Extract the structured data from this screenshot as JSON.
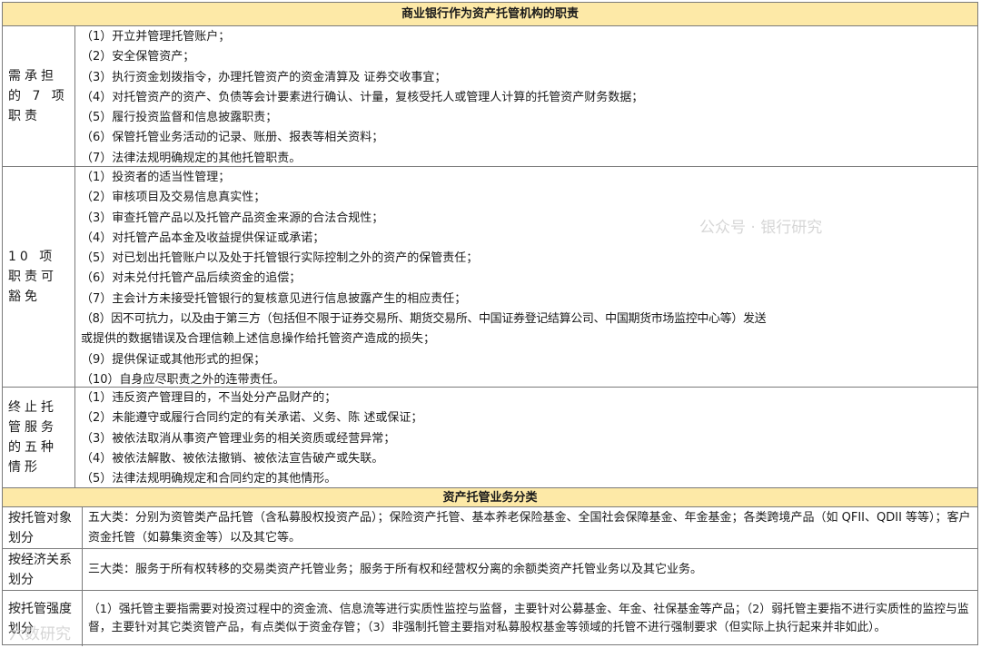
{
  "section1": {
    "title": "商业银行作为资产托管机构的职责",
    "rows": [
      {
        "label": "需承担的 7 项职责",
        "items": [
          "（1）开立并管理托管账户；",
          "（2）安全保管资产；",
          "（3）执行资金划拨指令，办理托管资产的资金清算及 证券交收事宜；",
          "（4）对托管资产的资产、负债等会计要素进行确认、计量，复核受托人或管理人计算的托管资产财务数据；",
          "（5）履行投资监督和信息披露职责；",
          "（6）保管托管业务活动的记录、账册、报表等相关资料；",
          "（7）法律法规明确规定的其他托管职责。"
        ]
      },
      {
        "label": "10 项职责可豁免",
        "items": [
          "（1）投资者的适当性管理；",
          "（2）审核项目及交易信息真实性；",
          "（3）审查托管产品以及托管产品资金来源的合法合规性；",
          "（4）对托管产品本金及收益提供保证或承诺；",
          "（5）对已划出托管账户以及处于托管银行实际控制之外的资产的保管责任；",
          "（6）对未兑付托管产品后续资金的追偿；",
          "（7）主会计方未接受托管银行的复核意见进行信息披露产生的相应责任；",
          "（8）因不可抗力，以及由于第三方（包括但不限于证券交易所、期货交易所、中国证券登记结算公司、中国期货市场监控中心等）发送",
          "或提供的数据错误及合理信赖上述信息操作给托管资产造成的损失；",
          "（9）提供保证或其他形式的担保；",
          "（10）自身应尽职责之外的连带责任。"
        ]
      },
      {
        "label": "终止托管服务的五种情形",
        "items": [
          "（1）违反资产管理目的，不当处分产品财产的；",
          "（2）未能遵守或履行合同约定的有关承诺、义务、陈 述或保证；",
          "（3）被依法取消从事资产管理业务的相关资质或经营异常；",
          "（4）被依法解散、被依法撤销、被依法宣告破产或失联。",
          "（5）法律法规明确规定和合同约定的其他情形。"
        ]
      }
    ]
  },
  "section2": {
    "title": "资产托管业务分类",
    "rows": [
      {
        "label": "按托管对象划分",
        "text": "五大类：分别为资管类产品托管（含私募股权投资产品）；保险资产托管、基本养老保险基金、全国社会保障基金、年金基金；各类跨境产品（如 QFII、QDII 等等）；客户资金托管（如募集资金等）以及其它等。"
      },
      {
        "label": "按经济关系划分",
        "text": "三大类：服务于所有权转移的交易类资产托管业务；服务于所有权和经营权分离的余额类资产托管业务以及其它业务。"
      },
      {
        "label": "按托管强度划分",
        "text": "（1）强托管主要指需要对投资过程中的资金流、信息流等进行实质性监控与监督，主要针对公募基金、年金、社保基金等产品；（2）弱托管主要指不进行实质性的监控与监督，主要针对其它类资管产品，有点类似于资金存管；（3）非强制托管主要指对私募股权基金等领域的托管不进行强制要求（但实际上执行起来并非如此）。"
      }
    ]
  },
  "watermarks": {
    "bottom_left": "六数研究",
    "right": "公众号 · 银行研究"
  }
}
